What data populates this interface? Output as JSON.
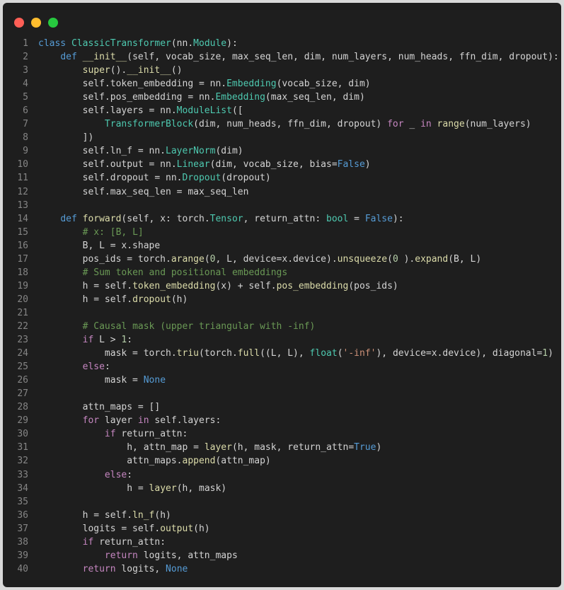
{
  "window": {
    "controls": {
      "close_color": "#ff5f56",
      "minimize_color": "#ffbd2e",
      "maximize_color": "#27c93f"
    }
  },
  "theme": {
    "background": "#1e1e1e",
    "text": "#d4d4d4",
    "line_number": "#858585",
    "keyword": "#569cd6",
    "control": "#c586c0",
    "function": "#dcdcaa",
    "class": "#4ec9b0",
    "number": "#b5cea8",
    "string": "#ce9178",
    "comment": "#6a9955"
  },
  "code": {
    "language": "python",
    "lines": [
      {
        "n": "1",
        "t": [
          [
            "kw",
            "class "
          ],
          [
            "cls",
            "ClassicTransformer"
          ],
          [
            "",
            "(nn."
          ],
          [
            "cls",
            "Module"
          ],
          [
            "",
            "):"
          ]
        ]
      },
      {
        "n": "2",
        "t": [
          [
            "",
            "    "
          ],
          [
            "kw",
            "def "
          ],
          [
            "fn",
            "__init__"
          ],
          [
            "",
            "(self, vocab_size, max_seq_len, dim, num_layers, num_heads, ffn_dim, dropout):"
          ]
        ]
      },
      {
        "n": "3",
        "t": [
          [
            "",
            "        "
          ],
          [
            "bi",
            "super"
          ],
          [
            "",
            "()."
          ],
          [
            "fn",
            "__init__"
          ],
          [
            "",
            "()"
          ]
        ]
      },
      {
        "n": "4",
        "t": [
          [
            "",
            "        self.token_embedding = nn."
          ],
          [
            "cls",
            "Embedding"
          ],
          [
            "",
            "(vocab_size, dim)"
          ]
        ]
      },
      {
        "n": "5",
        "t": [
          [
            "",
            "        self.pos_embedding = nn."
          ],
          [
            "cls",
            "Embedding"
          ],
          [
            "",
            "(max_seq_len, dim)"
          ]
        ]
      },
      {
        "n": "6",
        "t": [
          [
            "",
            "        self.layers = nn."
          ],
          [
            "cls",
            "ModuleList"
          ],
          [
            "",
            "(["
          ]
        ]
      },
      {
        "n": "7",
        "t": [
          [
            "",
            "            "
          ],
          [
            "cls",
            "TransformerBlock"
          ],
          [
            "",
            "(dim, num_heads, ffn_dim, dropout) "
          ],
          [
            "kw2",
            "for"
          ],
          [
            "",
            " _ "
          ],
          [
            "kw2",
            "in "
          ],
          [
            "bi",
            "range"
          ],
          [
            "",
            "(num_layers)"
          ]
        ]
      },
      {
        "n": "8",
        "t": [
          [
            "",
            "        ])"
          ]
        ]
      },
      {
        "n": "9",
        "t": [
          [
            "",
            "        self.ln_f = nn."
          ],
          [
            "cls",
            "LayerNorm"
          ],
          [
            "",
            "(dim)"
          ]
        ]
      },
      {
        "n": "10",
        "t": [
          [
            "",
            "        self.output = nn."
          ],
          [
            "cls",
            "Linear"
          ],
          [
            "",
            "(dim, vocab_size, bias="
          ],
          [
            "kw",
            "False"
          ],
          [
            "",
            ")"
          ]
        ]
      },
      {
        "n": "11",
        "t": [
          [
            "",
            "        self.dropout = nn."
          ],
          [
            "cls",
            "Dropout"
          ],
          [
            "",
            "(dropout)"
          ]
        ]
      },
      {
        "n": "12",
        "t": [
          [
            "",
            "        self.max_seq_len = max_seq_len"
          ]
        ]
      },
      {
        "n": "13",
        "t": [
          [
            "",
            ""
          ]
        ]
      },
      {
        "n": "14",
        "t": [
          [
            "",
            "    "
          ],
          [
            "kw",
            "def "
          ],
          [
            "fn",
            "forward"
          ],
          [
            "",
            "(self, x: torch."
          ],
          [
            "cls",
            "Tensor"
          ],
          [
            "",
            ", return_attn: "
          ],
          [
            "cls",
            "bool"
          ],
          [
            "",
            " = "
          ],
          [
            "kw",
            "False"
          ],
          [
            "",
            "):"
          ]
        ]
      },
      {
        "n": "15",
        "t": [
          [
            "",
            "        "
          ],
          [
            "cm",
            "# x: [B, L]"
          ]
        ]
      },
      {
        "n": "16",
        "t": [
          [
            "",
            "        B, L = x.shape"
          ]
        ]
      },
      {
        "n": "17",
        "t": [
          [
            "",
            "        pos_ids = torch."
          ],
          [
            "fn",
            "arange"
          ],
          [
            "",
            "("
          ],
          [
            "num",
            "0"
          ],
          [
            "",
            ", L, device=x.device)."
          ],
          [
            "fn",
            "unsqueeze"
          ],
          [
            "",
            "("
          ],
          [
            "num",
            "0"
          ],
          [
            "",
            " )."
          ],
          [
            "fn",
            "expand"
          ],
          [
            "",
            "(B, L)"
          ]
        ]
      },
      {
        "n": "18",
        "t": [
          [
            "",
            "        "
          ],
          [
            "cm",
            "# Sum token and positional embeddings"
          ]
        ]
      },
      {
        "n": "19",
        "t": [
          [
            "",
            "        h = self."
          ],
          [
            "fn",
            "token_embedding"
          ],
          [
            "",
            "(x) + self."
          ],
          [
            "fn",
            "pos_embedding"
          ],
          [
            "",
            "(pos_ids)"
          ]
        ]
      },
      {
        "n": "20",
        "t": [
          [
            "",
            "        h = self."
          ],
          [
            "fn",
            "dropout"
          ],
          [
            "",
            "(h)"
          ]
        ]
      },
      {
        "n": "21",
        "t": [
          [
            "",
            ""
          ]
        ]
      },
      {
        "n": "22",
        "t": [
          [
            "",
            "        "
          ],
          [
            "cm",
            "# Causal mask (upper triangular with -inf)"
          ]
        ]
      },
      {
        "n": "23",
        "t": [
          [
            "",
            "        "
          ],
          [
            "kw2",
            "if"
          ],
          [
            "",
            " L > "
          ],
          [
            "num",
            "1"
          ],
          [
            "",
            ":"
          ]
        ]
      },
      {
        "n": "24",
        "t": [
          [
            "",
            "            mask = torch."
          ],
          [
            "fn",
            "triu"
          ],
          [
            "",
            "(torch."
          ],
          [
            "fn",
            "full"
          ],
          [
            "",
            "((L, L), "
          ],
          [
            "cls",
            "float"
          ],
          [
            "",
            "("
          ],
          [
            "str",
            "'-inf'"
          ],
          [
            "",
            "), device=x.device), diagonal="
          ],
          [
            "num",
            "1"
          ],
          [
            "",
            ")"
          ]
        ]
      },
      {
        "n": "25",
        "t": [
          [
            "",
            "        "
          ],
          [
            "kw2",
            "else"
          ],
          [
            "",
            ":"
          ]
        ]
      },
      {
        "n": "26",
        "t": [
          [
            "",
            "            mask = "
          ],
          [
            "kw",
            "None"
          ]
        ]
      },
      {
        "n": "27",
        "t": [
          [
            "",
            ""
          ]
        ]
      },
      {
        "n": "28",
        "t": [
          [
            "",
            "        attn_maps = []"
          ]
        ]
      },
      {
        "n": "29",
        "t": [
          [
            "",
            "        "
          ],
          [
            "kw2",
            "for"
          ],
          [
            "",
            " layer "
          ],
          [
            "kw2",
            "in"
          ],
          [
            "",
            " self.layers:"
          ]
        ]
      },
      {
        "n": "30",
        "t": [
          [
            "",
            "            "
          ],
          [
            "kw2",
            "if"
          ],
          [
            "",
            " return_attn:"
          ]
        ]
      },
      {
        "n": "31",
        "t": [
          [
            "",
            "                h, attn_map = "
          ],
          [
            "fn",
            "layer"
          ],
          [
            "",
            "(h, mask, return_attn="
          ],
          [
            "kw",
            "True"
          ],
          [
            "",
            ")"
          ]
        ]
      },
      {
        "n": "32",
        "t": [
          [
            "",
            "                attn_maps."
          ],
          [
            "fn",
            "append"
          ],
          [
            "",
            "(attn_map)"
          ]
        ]
      },
      {
        "n": "33",
        "t": [
          [
            "",
            "            "
          ],
          [
            "kw2",
            "else"
          ],
          [
            "",
            ":"
          ]
        ]
      },
      {
        "n": "34",
        "t": [
          [
            "",
            "                h = "
          ],
          [
            "fn",
            "layer"
          ],
          [
            "",
            "(h, mask)"
          ]
        ]
      },
      {
        "n": "35",
        "t": [
          [
            "",
            ""
          ]
        ]
      },
      {
        "n": "36",
        "t": [
          [
            "",
            "        h = self."
          ],
          [
            "fn",
            "ln_f"
          ],
          [
            "",
            "(h)"
          ]
        ]
      },
      {
        "n": "37",
        "t": [
          [
            "",
            "        logits = self."
          ],
          [
            "fn",
            "output"
          ],
          [
            "",
            "(h)"
          ]
        ]
      },
      {
        "n": "38",
        "t": [
          [
            "",
            "        "
          ],
          [
            "kw2",
            "if"
          ],
          [
            "",
            " return_attn:"
          ]
        ]
      },
      {
        "n": "39",
        "t": [
          [
            "",
            "            "
          ],
          [
            "kw2",
            "return"
          ],
          [
            "",
            " logits, attn_maps"
          ]
        ]
      },
      {
        "n": "40",
        "t": [
          [
            "",
            "        "
          ],
          [
            "kw2",
            "return"
          ],
          [
            "",
            " logits, "
          ],
          [
            "kw",
            "None"
          ]
        ]
      }
    ]
  }
}
